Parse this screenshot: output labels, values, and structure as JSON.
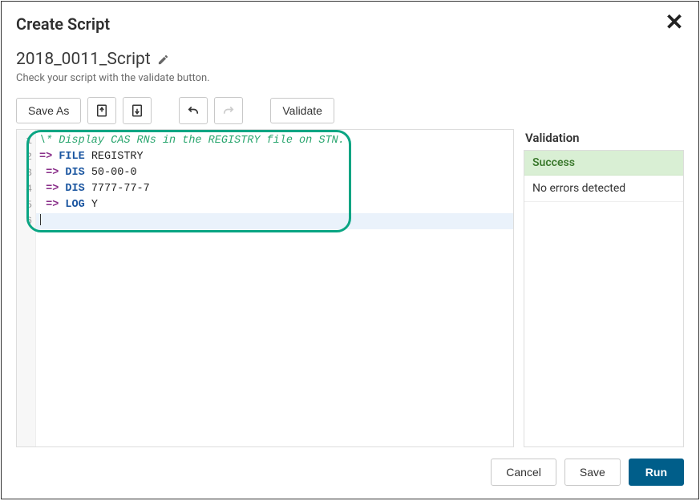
{
  "dialog": {
    "title": "Create Script",
    "close_glyph": "✕"
  },
  "script": {
    "name": "2018_0011_Script",
    "subtext": "Check your script with the validate button."
  },
  "toolbar": {
    "save_as_label": "Save As",
    "import_icon": "import-icon",
    "export_icon": "export-icon",
    "undo_icon": "undo-icon",
    "redo_icon": "redo-icon",
    "validate_label": "Validate"
  },
  "editor": {
    "line_numbers": [
      "1",
      "2",
      "3",
      "4",
      "5",
      "6"
    ],
    "lines": [
      {
        "tokens": [
          {
            "cls": "tok-comment",
            "text": "\\* Display CAS RNs in the REGISTRY file on STN."
          }
        ]
      },
      {
        "tokens": [
          {
            "cls": "tok-arrow",
            "text": "=>"
          },
          {
            "cls": "tok-plain",
            "text": " "
          },
          {
            "cls": "tok-kw",
            "text": "FILE"
          },
          {
            "cls": "tok-plain",
            "text": " REGISTRY"
          }
        ]
      },
      {
        "tokens": [
          {
            "cls": "tok-plain",
            "text": " "
          },
          {
            "cls": "tok-arrow",
            "text": "=>"
          },
          {
            "cls": "tok-plain",
            "text": " "
          },
          {
            "cls": "tok-kw",
            "text": "DIS"
          },
          {
            "cls": "tok-plain",
            "text": " 50-00-0"
          }
        ]
      },
      {
        "tokens": [
          {
            "cls": "tok-plain",
            "text": " "
          },
          {
            "cls": "tok-arrow",
            "text": "=>"
          },
          {
            "cls": "tok-plain",
            "text": " "
          },
          {
            "cls": "tok-kw",
            "text": "DIS"
          },
          {
            "cls": "tok-plain",
            "text": " 7777-77-7"
          }
        ]
      },
      {
        "tokens": [
          {
            "cls": "tok-plain",
            "text": " "
          },
          {
            "cls": "tok-arrow",
            "text": "=>"
          },
          {
            "cls": "tok-plain",
            "text": " "
          },
          {
            "cls": "tok-kw",
            "text": "LOG"
          },
          {
            "cls": "tok-plain",
            "text": " Y"
          }
        ]
      },
      {
        "tokens": [],
        "active": true
      }
    ]
  },
  "validation": {
    "heading": "Validation",
    "status_label": "Success",
    "message": "No errors detected"
  },
  "footer": {
    "cancel_label": "Cancel",
    "save_label": "Save",
    "run_label": "Run"
  }
}
